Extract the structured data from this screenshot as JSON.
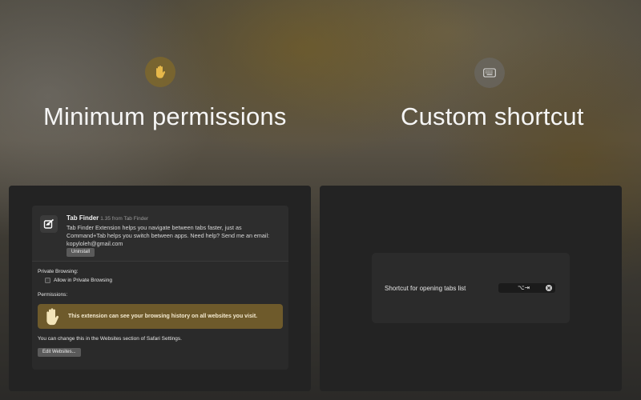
{
  "features": {
    "left": {
      "title": "Minimum permissions",
      "icon": "raised-hand-icon",
      "icon_color": "#e0b040"
    },
    "right": {
      "title": "Custom shortcut",
      "icon": "keyboard-icon",
      "icon_color": "#d8d8d8"
    }
  },
  "extension": {
    "name": "Tab Finder",
    "version_source": "1.35 from Tab Finder",
    "description": "Tab Finder Extension helps you navigate between tabs faster, just as Command+Tab helps you switch between apps. Need help? Send me an email: kopyloleh@gmail.com",
    "uninstall_label": "Uninstall",
    "private_browsing_label": "Private Browsing:",
    "allow_private_label": "Allow in Private Browsing",
    "allow_private_checked": false,
    "permissions_label": "Permissions:",
    "permission_warning": "This extension can see your browsing history on all websites you visit.",
    "settings_note": "You can change this in the Websites section of Safari Settings.",
    "edit_websites_label": "Edit Websites...",
    "warning_color": "#6e5a2b"
  },
  "shortcut": {
    "label": "Shortcut for opening tabs list",
    "value": "⌥⇥"
  }
}
